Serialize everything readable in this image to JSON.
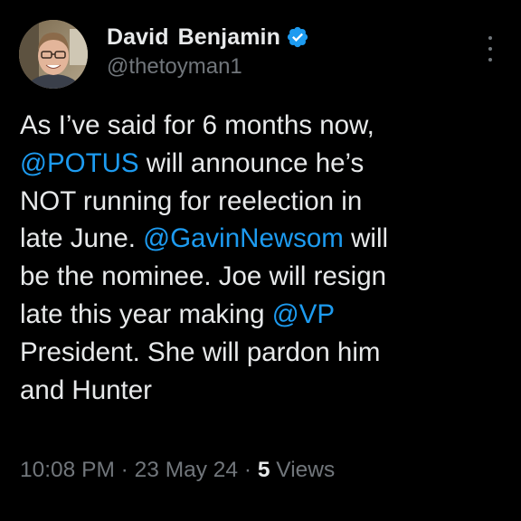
{
  "author": {
    "display_name": "David Benjamin",
    "handle": "@thetoyman1",
    "verified": true,
    "avatar_icon": "avatar-photo"
  },
  "more_icon": "more-options-icon",
  "tweet": {
    "lines": [
      [
        {
          "text": "As I’ve said for 6 months now,",
          "mention": false
        }
      ],
      [
        {
          "text": "@POTUS",
          "mention": true
        },
        {
          "text": " will announce he’s",
          "mention": false
        }
      ],
      [
        {
          "text": "NOT running for reelection in",
          "mention": false
        }
      ],
      [
        {
          "text": "late June. ",
          "mention": false
        },
        {
          "text": "@GavinNewsom",
          "mention": true
        },
        {
          "text": " will",
          "mention": false
        }
      ],
      [
        {
          "text": "be the nominee. Joe will resign",
          "mention": false
        }
      ],
      [
        {
          "text": "late this year making ",
          "mention": false
        },
        {
          "text": "@VP",
          "mention": true
        }
      ],
      [
        {
          "text": "President. She will pardon him",
          "mention": false
        }
      ],
      [
        {
          "text": "and Hunter",
          "mention": false
        }
      ]
    ]
  },
  "meta": {
    "time": "10:08 PM",
    "separator": " · ",
    "date": "23 May 24",
    "views_count": "5",
    "views_label": " Views"
  },
  "colors": {
    "background": "#000000",
    "text": "#e7e9ea",
    "secondary": "#71767b",
    "accent": "#1d9bf0"
  }
}
